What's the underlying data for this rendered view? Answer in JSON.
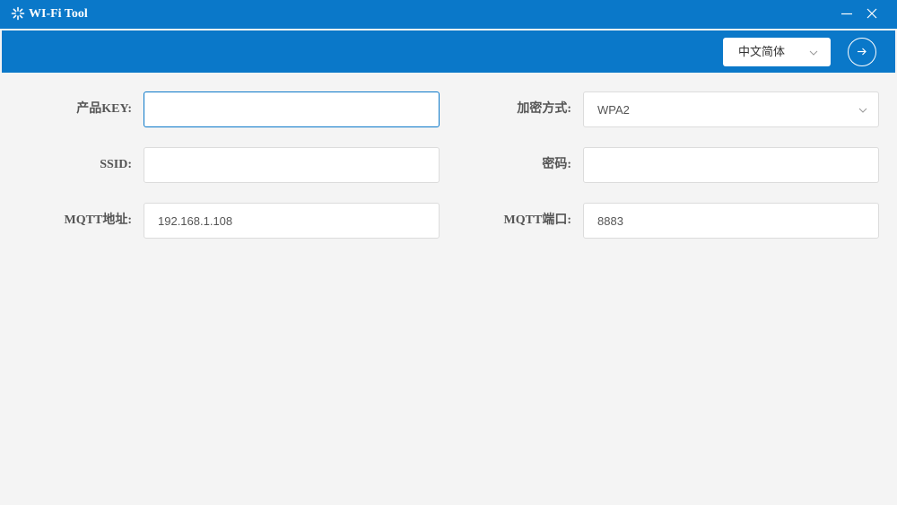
{
  "window": {
    "title": "WI-Fi Tool",
    "icon": "wifi-tool-icon",
    "minimize_icon": "minimize-icon",
    "close_icon": "close-icon"
  },
  "toolbar": {
    "language": {
      "selected": "中文简体"
    },
    "submit_icon": "arrow-right-icon"
  },
  "form": {
    "product_key": {
      "label": "产品KEY:",
      "value": ""
    },
    "encryption": {
      "label": "加密方式:",
      "value": "WPA2"
    },
    "ssid": {
      "label": "SSID:",
      "value": ""
    },
    "password": {
      "label": "密码:",
      "value": ""
    },
    "mqtt_address": {
      "label": "MQTT地址:",
      "value": "192.168.1.108"
    },
    "mqtt_port": {
      "label": "MQTT端口:",
      "value": "8883"
    }
  },
  "colors": {
    "accent": "#0a78c9",
    "background": "#f4f4f4",
    "field_border": "#dcdcdc"
  }
}
